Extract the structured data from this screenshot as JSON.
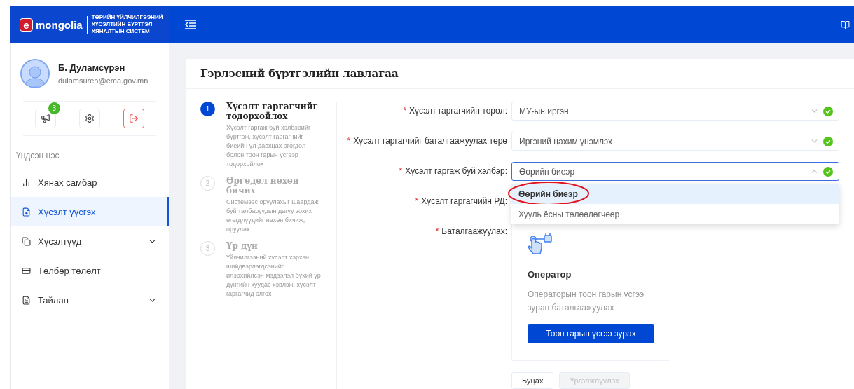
{
  "header": {
    "logo_letter": "e",
    "logo_text": "mongolia",
    "system_title": [
      "ТӨРИЙН ҮЙЛЧИЛГЭЭНИЙ",
      "ХҮСЭЛТИЙН БҮРТГЭЛ",
      "ХЯНАЛТЫН СИСТЕМ"
    ]
  },
  "user": {
    "name": "Б. Дуламсүрэн",
    "email": "dulamsuren@ema.gov.mn"
  },
  "actions": [
    {
      "kind": "notify",
      "badge": "3"
    },
    {
      "kind": "settings"
    },
    {
      "kind": "logout"
    }
  ],
  "menu": {
    "heading": "Үндсэн цэс",
    "items": [
      {
        "kind": "dashboard",
        "label": "Хянах самбар",
        "selected": false,
        "expandable": false
      },
      {
        "kind": "create",
        "label": "Хүсэлт үүсгэх",
        "selected": true,
        "expandable": false
      },
      {
        "kind": "requests",
        "label": "Хүсэлтүүд",
        "selected": false,
        "expandable": true
      },
      {
        "kind": "payment",
        "label": "Төлбөр төлөлт",
        "selected": false,
        "expandable": false
      },
      {
        "kind": "report",
        "label": "Тайлан",
        "selected": false,
        "expandable": true
      }
    ]
  },
  "page": {
    "title": "Гэрлэсний бүртгэлийн лавлагаа"
  },
  "steps": [
    {
      "number": "1",
      "title": "Хүсэлт гаргагчийг тодорхойлох",
      "description": "Хүсэлт гаргаж буй хэлбэрийг бүртгэж, хүсэлт гаргагчийг биеийн үл давхцах өгөгдөл болон тоон гарын үсгээр тодорхойлох",
      "active": true
    },
    {
      "number": "2",
      "title": "Өргөдөл нөхөн бичих",
      "description": "Системээс оруулахыг шаардаж буй талбаруудын дагуу зохих өгөгдлүүдийг нөхөн бичиж, оруулах",
      "active": false
    },
    {
      "number": "3",
      "title": "Үр дүн",
      "description": "Үйлчилгээний хүсэлт хэрхэн шийдвэрлэгдсэнийг илэрхийлсэн мэдээлэл бүхий үр дүнгийн хуудас хэвлэж, хүсэлт гаргагчид олгох",
      "active": false
    }
  ],
  "fields": [
    {
      "kind": "select",
      "required_mark": "*",
      "label": "Хүсэлт гаргагчийн төрөл:",
      "value": "МУ-ын иргэн",
      "open": false,
      "valid": true
    },
    {
      "kind": "select",
      "required_mark": "*",
      "label": "Хүсэлт гаргагчийг баталгаажуулах төрө",
      "value": "Иргэний цахим үнэмлэх",
      "open": false,
      "valid": true
    },
    {
      "kind": "select",
      "required_mark": "*",
      "label": "Хүсэлт гаргаж буй хэлбэр:",
      "value": "Өөрийн биеэр",
      "open": true,
      "valid": true,
      "options": [
        {
          "label": "Өөрийн биеэр",
          "selected": true
        },
        {
          "label": "Хууль ёсны төлөөлөгчөөр",
          "selected": false
        }
      ]
    },
    {
      "kind": "input",
      "required_mark": "*",
      "label": "Хүсэлт гаргагчийн РД:"
    },
    {
      "kind": "card",
      "required_mark": "*",
      "label": "Баталгаажуулах:",
      "title": "Оператор",
      "description": "Операторын тоон гарын үсгээ зуран баталгаажуулах",
      "button": "Тоон гарын үсгээ зурах"
    }
  ],
  "footer_buttons": [
    {
      "label": "Буцах",
      "disabled": false
    },
    {
      "label": "Үргэлжлүүлэх",
      "disabled": true
    }
  ]
}
